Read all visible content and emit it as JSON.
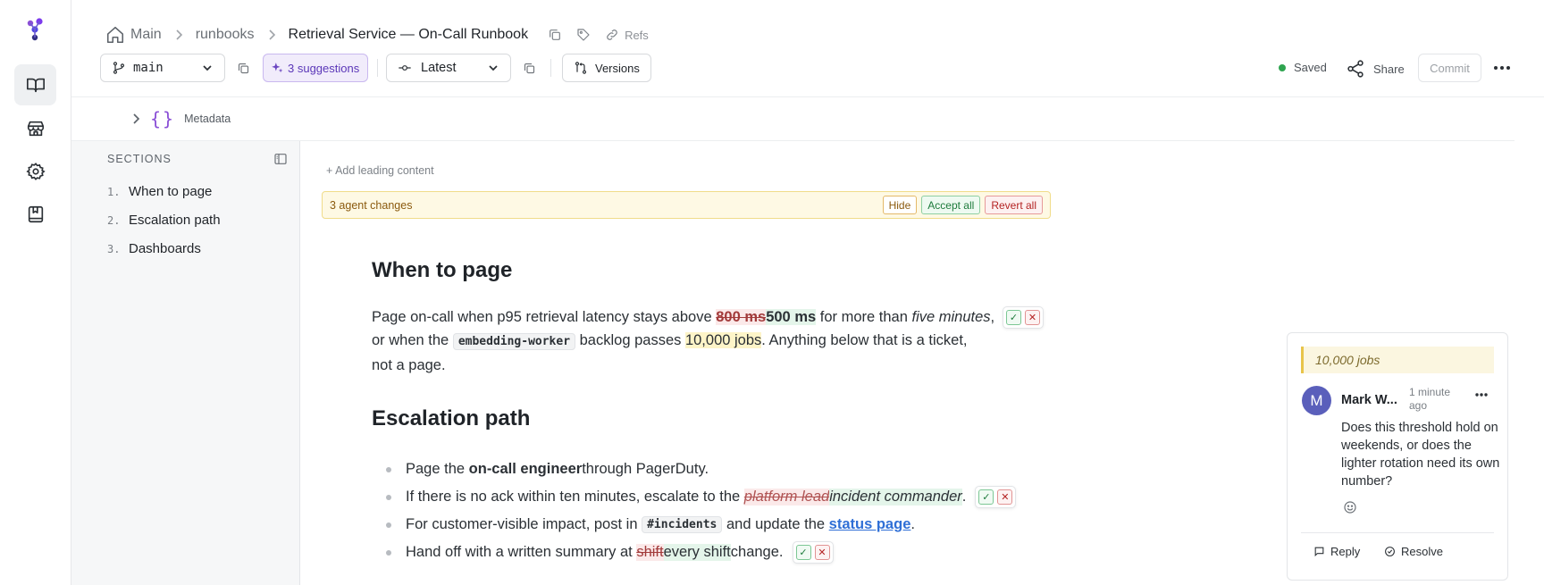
{
  "breadcrumb": {
    "home": "Main",
    "folder": "runbooks",
    "current": "Retrieval Service — On-Call Runbook",
    "refs": "Refs"
  },
  "toolbar": {
    "branch": "main",
    "suggestions": "3 suggestions",
    "version": "Latest",
    "versions": "Versions",
    "saved": "Saved",
    "share": "Share",
    "commit": "Commit"
  },
  "metadata_label": "Metadata",
  "sidebar": {
    "title": "SECTIONS",
    "items": [
      {
        "num": "1.",
        "label": "When to page"
      },
      {
        "num": "2.",
        "label": "Escalation path"
      },
      {
        "num": "3.",
        "label": "Dashboards"
      }
    ]
  },
  "editor": {
    "add_leading": "+ Add leading content",
    "banner": {
      "text": "3 agent changes",
      "hide": "Hide",
      "accept_all": "Accept all",
      "revert_all": "Revert all"
    },
    "section1": {
      "heading": "When to page",
      "p1": "Page on-call when p95 retrieval latency stays above ",
      "deleted": "800 ms",
      "inserted": "500 ms",
      "p2": " for more than ",
      "em": "five minutes",
      "p3": ",",
      "p4": "or when the ",
      "code": "embedding-worker",
      "p5": " backlog passes ",
      "highlight": "10,000 jobs",
      "p6": ". Anything below that is a ticket,",
      "p7": "not a page."
    },
    "section2": {
      "heading": "Escalation path",
      "b1_pre": "Page the ",
      "b1_bold": "on-call engineer",
      "b1_post": " through PagerDuty.",
      "b2_pre": "If there is no ack within ten minutes, escalate to the ",
      "b2_del": "platform lead",
      "b2_ins": "incident commander",
      "b2_post": ".",
      "b3_pre": "For customer-visible impact, post in ",
      "b3_code": "#incidents",
      "b3_mid": " and update the ",
      "b3_link": "status page",
      "b3_post": ".",
      "b4_pre": "Hand off with a written summary at ",
      "b4_del": "shift",
      "b4_ins": "every shift",
      "b4_post": " change."
    },
    "accept_glyph": "✓",
    "reject_glyph": "✕"
  },
  "comment": {
    "quote": "10,000 jobs",
    "avatar_initial": "M",
    "author": "Mark W...",
    "time_line1": "1 minute",
    "time_line2": "ago",
    "body": "Does this threshold hold on weekends, or does the lighter rotation need its own number?",
    "reply": "Reply",
    "resolve": "Resolve"
  }
}
